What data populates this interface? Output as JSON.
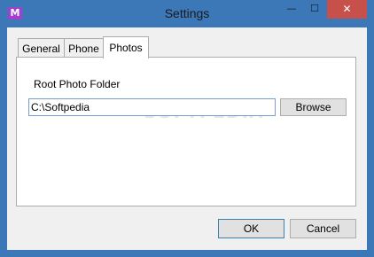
{
  "window": {
    "title": "Settings",
    "app_icon_glyph": "M",
    "controls": {
      "minimize": "—",
      "maximize": "☐",
      "close": "✕"
    }
  },
  "tabs": [
    {
      "label": "General",
      "selected": false
    },
    {
      "label": "Phone",
      "selected": false
    },
    {
      "label": "Photos",
      "selected": true
    }
  ],
  "photos_tab": {
    "root_folder_label": "Root Photo Folder",
    "root_folder_value": "C:\\Softpedia",
    "browse_label": "Browse"
  },
  "footer": {
    "ok_label": "OK",
    "cancel_label": "Cancel"
  },
  "watermark": "SOFTPEDIA",
  "colors": {
    "title_bar": "#3c78b8",
    "close_button": "#c7504a",
    "app_icon": "#a13fd0"
  }
}
